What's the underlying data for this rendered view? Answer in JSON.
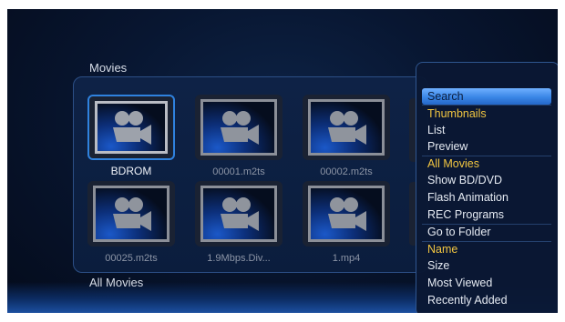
{
  "page": {
    "title": "Movies",
    "filter_label": "All Movies"
  },
  "grid": {
    "items": [
      {
        "label": "BDROM",
        "selected": true
      },
      {
        "label": "00001.m2ts"
      },
      {
        "label": "00002.m2ts"
      },
      {
        "label": "00025.m2ts"
      },
      {
        "label": "1.9Mbps.Div..."
      },
      {
        "label": "1.mp4"
      }
    ],
    "thumb_icon": "movie-camera-icon"
  },
  "menu": {
    "items": [
      {
        "label": "Search",
        "state": "highlight"
      },
      {
        "label": "Thumbnails",
        "state": "active"
      },
      {
        "label": "List"
      },
      {
        "label": "Preview"
      },
      {
        "label": "All Movies",
        "state": "active"
      },
      {
        "label": "Show BD/DVD"
      },
      {
        "label": "Flash Animation"
      },
      {
        "label": "REC Programs"
      },
      {
        "label": "Go to Folder"
      },
      {
        "label": "Name",
        "state": "active"
      },
      {
        "label": "Size"
      },
      {
        "label": "Most Viewed"
      },
      {
        "label": "Recently Added"
      }
    ]
  },
  "colors": {
    "highlight": "#3a86e6",
    "active_text": "#f2c641",
    "background": "#081631"
  }
}
